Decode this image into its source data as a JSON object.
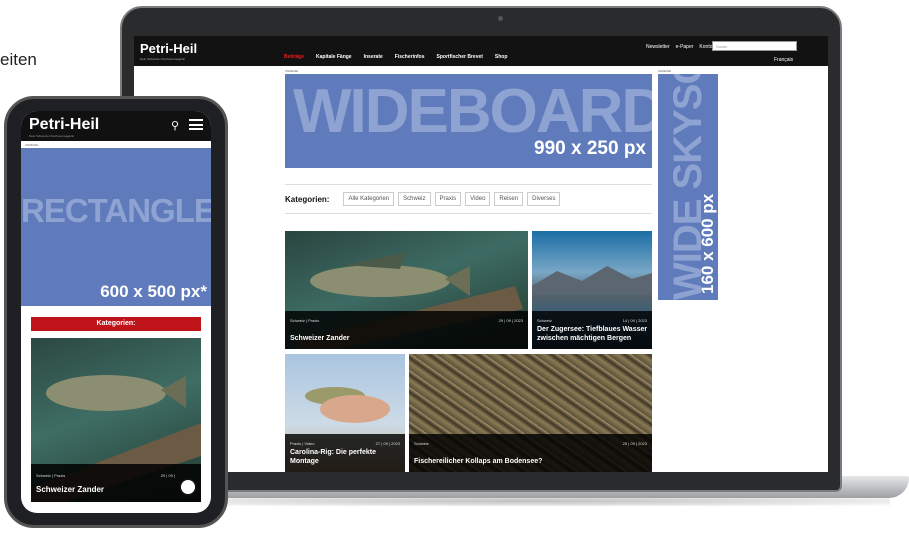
{
  "edge_text": "eiten",
  "desktop": {
    "logo": "Petri-Heil",
    "logo_tagline": "Dein Schweizer Fischereimagazin",
    "nav": [
      "Beiträge",
      "Kapitale Fänge",
      "Inserate",
      "Fischerinfos",
      "Sportfischer Brevet",
      "Shop"
    ],
    "utility": [
      "Newsletter",
      "e-Paper",
      "Konto"
    ],
    "search_placeholder": "Suche",
    "language": "Français",
    "ad_label": "ANZEIGE",
    "wideboard": {
      "label": "WIDEBOARD",
      "size": "990 x 250 px"
    },
    "skyscraper": {
      "label": "WIDE SKYSCRAPER",
      "size": "160 x 600 px"
    },
    "categories": {
      "title": "Kategorien:",
      "items": [
        "Alle Kategorien",
        "Schweiz",
        "Praxis",
        "Video",
        "Reisen",
        "Diverses"
      ]
    },
    "articles": [
      {
        "meta": "Schweiz | Praxis",
        "date": "29 | 09 | 2023",
        "title": "Schweizer Zander"
      },
      {
        "meta": "Schweiz",
        "date": "14 | 09 | 2023",
        "title": "Der Zugersee: Tiefblaues Wasser zwischen mächtigen Bergen"
      },
      {
        "meta": "Praxis | Video",
        "date": "27 | 09 | 2023",
        "title": "Carolina-Rig: Die perfekte Montage"
      },
      {
        "meta": "Schweiz",
        "date": "25 | 09 | 2023",
        "title": "Fischereilicher Kollaps am Bodensee?"
      }
    ]
  },
  "mobile": {
    "logo": "Petri-Heil",
    "logo_tagline": "Dein Schweizer Fischereimagazin",
    "ad_label": "ANZEIGE",
    "rectangle": {
      "label": "RECTANGLE",
      "size": "600 x 500 px*"
    },
    "categories_button": "Kategorien:",
    "article": {
      "meta": "Schweiz | Praxis",
      "date": "29 | 09 |",
      "title": "Schweizer Zander"
    }
  },
  "colors": {
    "ad_blue": "#5f7bbb",
    "ad_light": "#8fa3d3",
    "accent_red": "#c0141b",
    "header": "#121212"
  },
  "icons": [
    "search-icon",
    "menu-icon"
  ]
}
